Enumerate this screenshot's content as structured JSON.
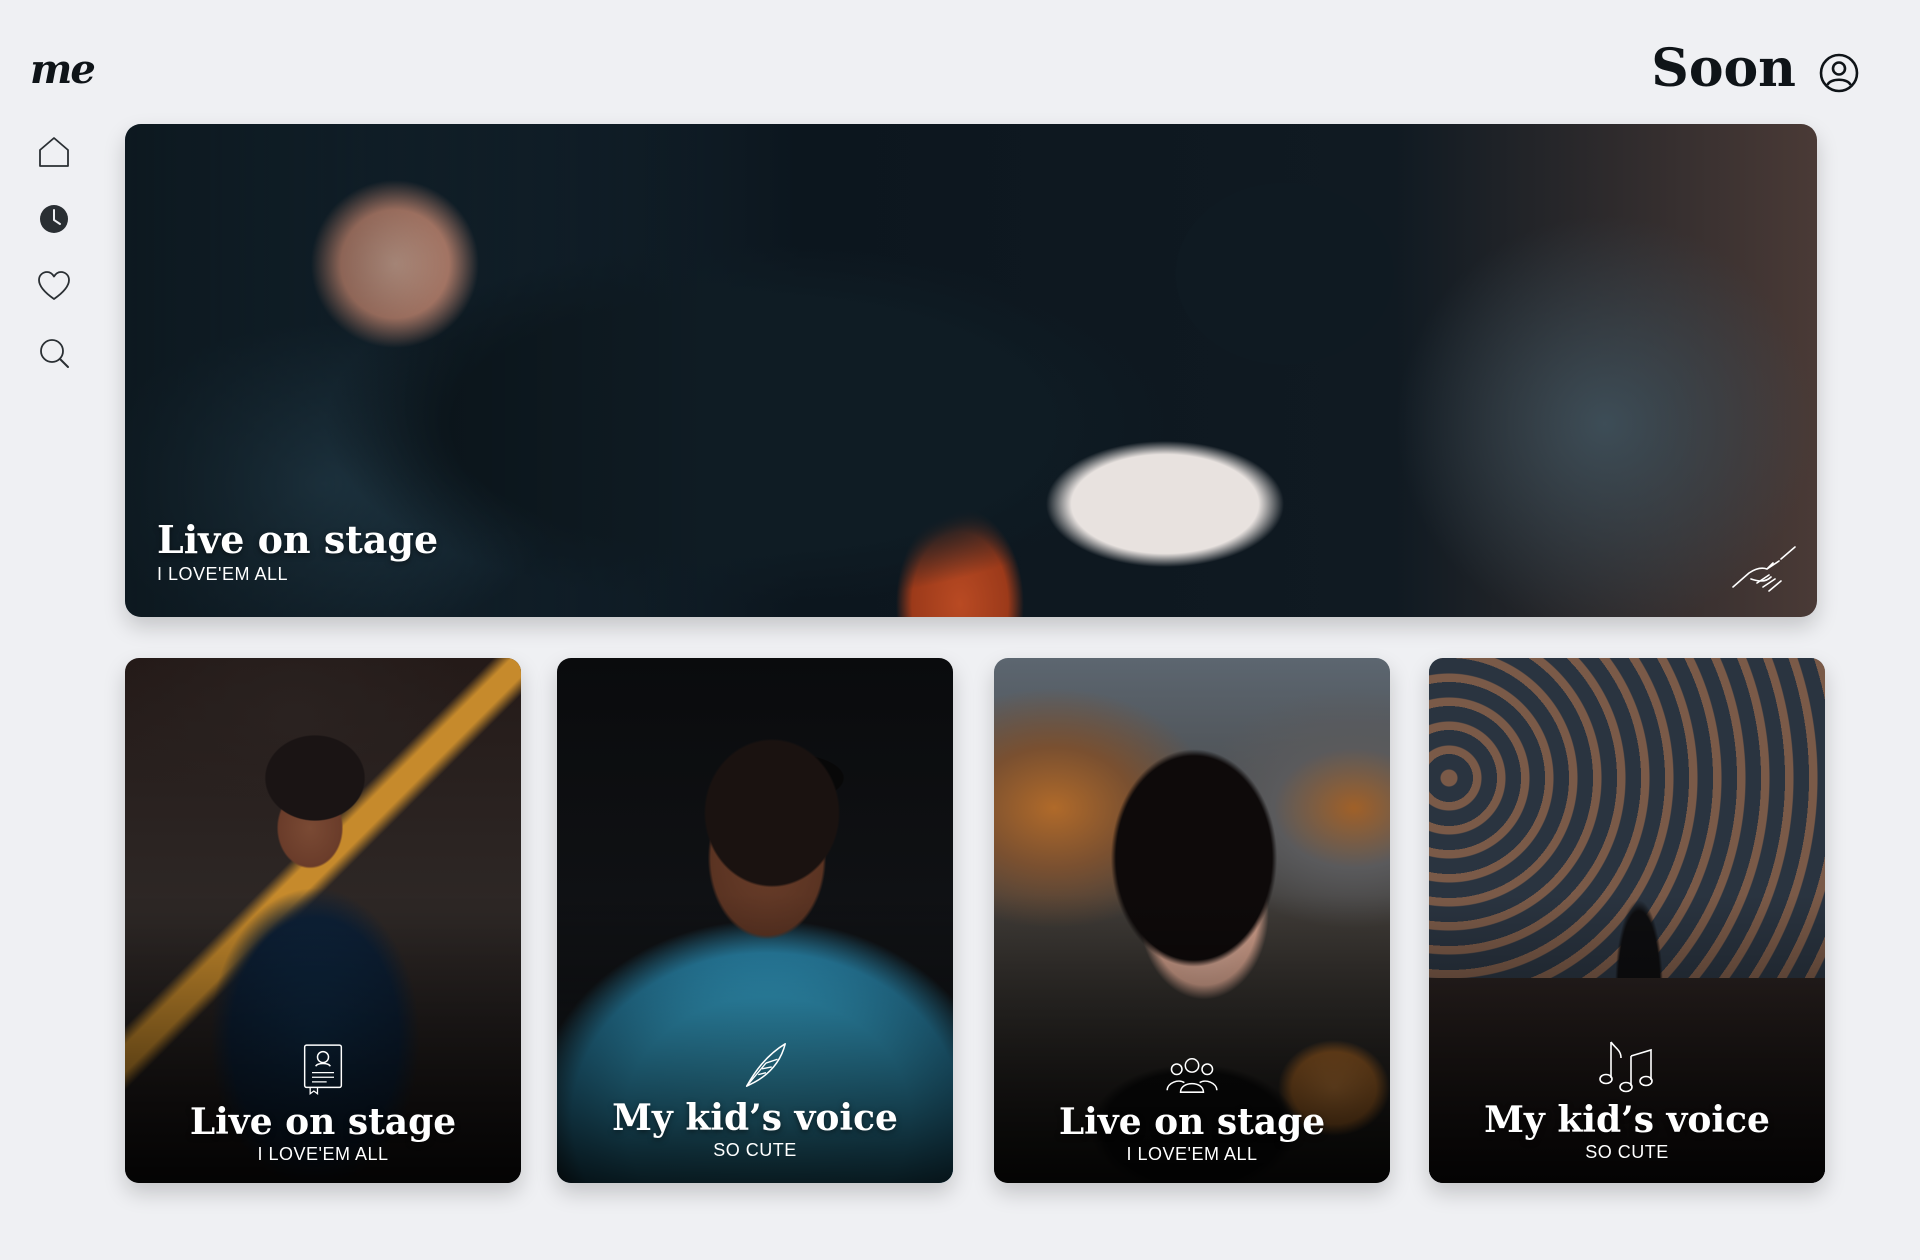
{
  "brand": {
    "logo_text": "me"
  },
  "header": {
    "title": "Soon",
    "profile_icon": "user-circle-icon"
  },
  "sidebar": {
    "items": [
      {
        "name": "home",
        "icon": "home-icon",
        "active": false
      },
      {
        "name": "recent",
        "icon": "clock-icon",
        "active": true
      },
      {
        "name": "favorites",
        "icon": "heart-icon",
        "active": false
      },
      {
        "name": "search",
        "icon": "search-icon",
        "active": false
      }
    ]
  },
  "hero": {
    "title": "Live on stage",
    "subtitle": "I LOVE'EM ALL",
    "icon": "handshake-icon"
  },
  "cards": [
    {
      "title": "Live on stage",
      "subtitle": "I LOVE'EM ALL",
      "icon": "certificate-icon"
    },
    {
      "title": "My kid’s voice",
      "subtitle": "SO CUTE",
      "icon": "quill-icon"
    },
    {
      "title": "Live on stage",
      "subtitle": "I LOVE'EM ALL",
      "icon": "group-icon"
    },
    {
      "title": "My kid’s voice",
      "subtitle": "SO CUTE",
      "icon": "music-notes-icon"
    }
  ],
  "colors": {
    "background": "#eff0f3",
    "text_dark": "#0f1418",
    "overlay_text": "#ffffff"
  }
}
